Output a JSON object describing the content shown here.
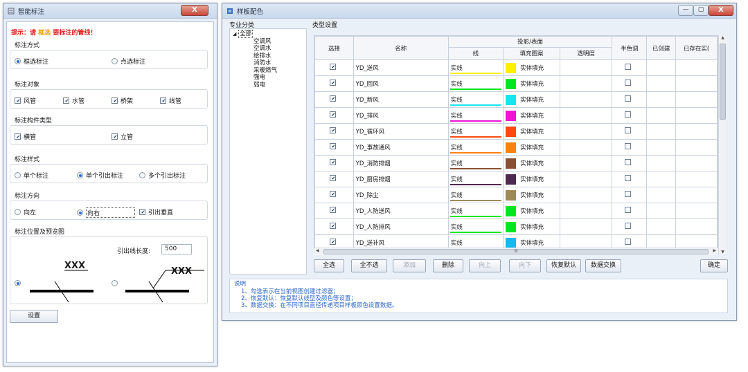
{
  "left": {
    "title": "智能标注",
    "close": "X",
    "hint": {
      "prefix": "提示：请",
      "highlight": "框选",
      "suffix": "要标注的管线！"
    },
    "method": {
      "title": "标注方式",
      "opt1": "框选标注",
      "opt2": "点选标注"
    },
    "object": {
      "title": "标注对象",
      "c1": "风管",
      "c2": "水管",
      "c3": "桥架",
      "c4": "线管"
    },
    "member": {
      "title": "标注构件类型",
      "c1": "横管",
      "c2": "立管"
    },
    "style": {
      "title": "标注样式",
      "opt1": "单个标注",
      "opt2": "单个引出标注",
      "opt3": "多个引出标注"
    },
    "direction": {
      "title": "标注方向",
      "opt1": "向左",
      "opt2": "向右",
      "chk": "引出垂直"
    },
    "preview": {
      "title": "标注位置及预览图",
      "lead_label": "引出线长度:",
      "lead_value": "500",
      "sample_text1": "XXX",
      "sample_text2": "XXX"
    },
    "settings_button": "设置"
  },
  "right": {
    "title": "样板配色",
    "category": {
      "title": "专业分类",
      "root": "全部",
      "items": [
        "空调风",
        "空调水",
        "给排水",
        "消防水",
        "采暖燃气",
        "强电",
        "弱电"
      ]
    },
    "typeset": {
      "title": "类型设置"
    },
    "columns": {
      "select": "选择",
      "name": "名称",
      "proj": "投影/表面",
      "line": "线",
      "fill": "填充图案",
      "transparency": "透明度",
      "halftone": "半色调",
      "created": "已创建",
      "exists": "已存在实("
    },
    "rows": [
      {
        "name": "YD_送风",
        "line": "实线",
        "fill": "实体填充",
        "color": "#ffef00",
        "checked": true
      },
      {
        "name": "YD_回风",
        "line": "实线",
        "fill": "实体填充",
        "color": "#00e61e",
        "checked": true
      },
      {
        "name": "YD_新风",
        "line": "实线",
        "fill": "实体填充",
        "color": "#17e6f0",
        "checked": true
      },
      {
        "name": "YD_排风",
        "line": "实线",
        "fill": "实体填充",
        "color": "#f014d8",
        "checked": true
      },
      {
        "name": "YD_循环风",
        "line": "实线",
        "fill": "实体填充",
        "color": "#ff4a0c",
        "checked": true
      },
      {
        "name": "YD_事故通风",
        "line": "实线",
        "fill": "实体填充",
        "color": "#ff8010",
        "checked": true
      },
      {
        "name": "YD_消防排烟",
        "line": "实线",
        "fill": "实体填充",
        "color": "#8a5032",
        "checked": true
      },
      {
        "name": "YD_厨房排烟",
        "line": "实线",
        "fill": "实体填充",
        "color": "#4f2a50",
        "checked": true
      },
      {
        "name": "YD_除尘",
        "line": "实线",
        "fill": "实体填充",
        "color": "#9e8a55",
        "checked": true
      },
      {
        "name": "YD_人防送风",
        "line": "实线",
        "fill": "实体填充",
        "color": "#00e61e",
        "checked": true
      },
      {
        "name": "YD_人防排风",
        "line": "实线",
        "fill": "实体填充",
        "color": "#00e61e",
        "checked": true
      },
      {
        "name": "YD_送补风",
        "line": "实线",
        "fill": "实体填充",
        "color": "#17b8f0",
        "checked": true
      }
    ],
    "hscroll_label": "III",
    "buttons": {
      "select_all": "全选",
      "select_none": "全不选",
      "add": "添加",
      "delete": "删除",
      "up": "向上",
      "down": "向下",
      "restore": "恢复默认",
      "exchange": "数据交换",
      "ok": "确定"
    },
    "notes": {
      "title": "说明",
      "n1": "1、勾选表示在当前视图创建过滤器；",
      "n2": "2、恢复默认：恢复默认线型及颜色等设置；",
      "n3": "3、数据交换：在不同项目直径传递项目样板颜色设置数据。"
    }
  }
}
